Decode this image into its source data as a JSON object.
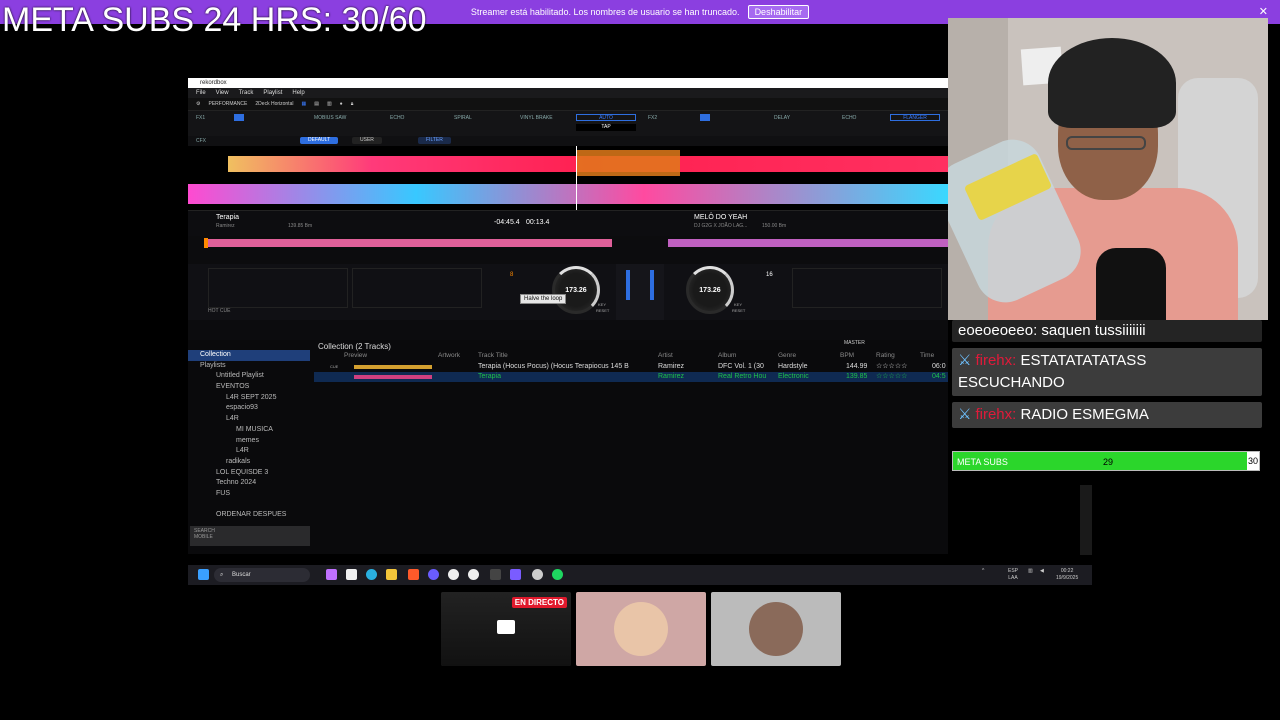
{
  "overlay": {
    "goal_text": "META  SUBS 24 HRS: 30/60"
  },
  "banner": {
    "message": "Streamer está habilitado. Los nombres de usuario se han truncado.",
    "button_label": "Deshabilitar",
    "close": "✕"
  },
  "rekordbox": {
    "window_title": "rekordbox",
    "menu": [
      "File",
      "View",
      "Track",
      "Playlist",
      "Help"
    ],
    "mode": "PERFORMANCE",
    "layout": "2Deck Horizontal",
    "fx1_label": "FX1",
    "fx2_label": "FX2",
    "cfx_label": "CFX",
    "fx_effects_left": [
      "MOBIUS SAW",
      "ECHO",
      "SPIRAL",
      "VINYL BRAKE"
    ],
    "fx_effects_right": [
      "DELAY",
      "ECHO",
      "FLANGER"
    ],
    "auto_label": "AUTO",
    "tap_label": "TAP",
    "cfx_pills": [
      "DEFAULT",
      "USER",
      "FILTER"
    ],
    "deck1": {
      "title": "Terapia",
      "artist": "Ramirez",
      "bpm_meta": "139.85 Bm",
      "time_remaining": "-04:45.4",
      "time_elapsed": "00:13.4",
      "jog_bpm": "173.26",
      "loop_size": "8",
      "key_label": "KEY",
      "reset_label": "RESET"
    },
    "deck2": {
      "title": "MELÔ DO YEAH",
      "artist": "DJ G2G X JOÃO LAG...",
      "bpm_meta": "150.00 Bm",
      "jog_bpm": "173.26",
      "loop_size": "16",
      "key_label": "KEY",
      "reset_label": "RESET"
    },
    "tooltip": "Halve the loop",
    "hot_cue_label": "HOT CUE",
    "browser": {
      "header": "Collection (2 Tracks)",
      "master_label": "MASTER",
      "tree": [
        {
          "label": "Collection",
          "level": 0,
          "selected": true
        },
        {
          "label": "Playlists",
          "level": 0
        },
        {
          "label": "Untitled Playlist",
          "level": 1
        },
        {
          "label": "EVENTOS",
          "level": 1
        },
        {
          "label": "L4R SEPT 2025",
          "level": 2
        },
        {
          "label": "espacio93",
          "level": 2
        },
        {
          "label": "L4R",
          "level": 2
        },
        {
          "label": "MI MUSICA",
          "level": 3
        },
        {
          "label": "memes",
          "level": 3
        },
        {
          "label": "L4R",
          "level": 3
        },
        {
          "label": "radikals",
          "level": 2
        },
        {
          "label": "LOL EQUISDE 3",
          "level": 1
        },
        {
          "label": "Techno 2024",
          "level": 1
        },
        {
          "label": "FUS",
          "level": 1
        },
        {
          "label": "ORDENAR DESPUES",
          "level": 1
        }
      ],
      "search_label": "SEARCH",
      "search_sub": "MOBILE",
      "columns": [
        "Preview",
        "Artwork",
        "Track Title",
        "Artist",
        "Album",
        "Genre",
        "BPM",
        "Rating",
        "Time"
      ],
      "rows": [
        {
          "cue": "CUE",
          "title": "Terapia (Hocus Pocus) (Hocus Terapiocus 145 B",
          "artist": "Ramirez",
          "album": "DFC Vol. 1 (30",
          "genre": "Hardstyle",
          "bpm": "144.99",
          "rating": "☆☆☆☆☆",
          "time": "06:0"
        },
        {
          "cue": "",
          "title": "Terapia",
          "artist": "Ramirez",
          "album": "Real Retro Hou",
          "genre": "Electronic",
          "bpm": "139.85",
          "rating": "☆☆☆☆☆",
          "time": "04:5"
        }
      ]
    }
  },
  "taskbar": {
    "search_placeholder": "Buscar",
    "lang": "ESP",
    "lang2": "LAA",
    "time": "00:22",
    "date": "19/9/2025"
  },
  "chat": [
    {
      "user": "eoeoeoeeo:",
      "text": " saquen tussiiiiiii",
      "user_color": "white",
      "pinned": false
    },
    {
      "user": "firehx:",
      "text": " ESTATATATATASS ESCUCHANDO",
      "user_color": "red",
      "pinned": true
    },
    {
      "user": "firehx:",
      "text": " RADIO ESMEGMA",
      "user_color": "red",
      "pinned": true
    }
  ],
  "subs_bar": {
    "label": "META SUBS",
    "current": "29",
    "goal": "30",
    "progress": 0.967
  },
  "participants": {
    "live_badge": "EN DIRECTO"
  },
  "colors": {
    "banner": "#8b3fe0",
    "subs_green": "#2bd62b",
    "chat_user_red": "#e01a3a",
    "live_red": "#e0192c"
  }
}
